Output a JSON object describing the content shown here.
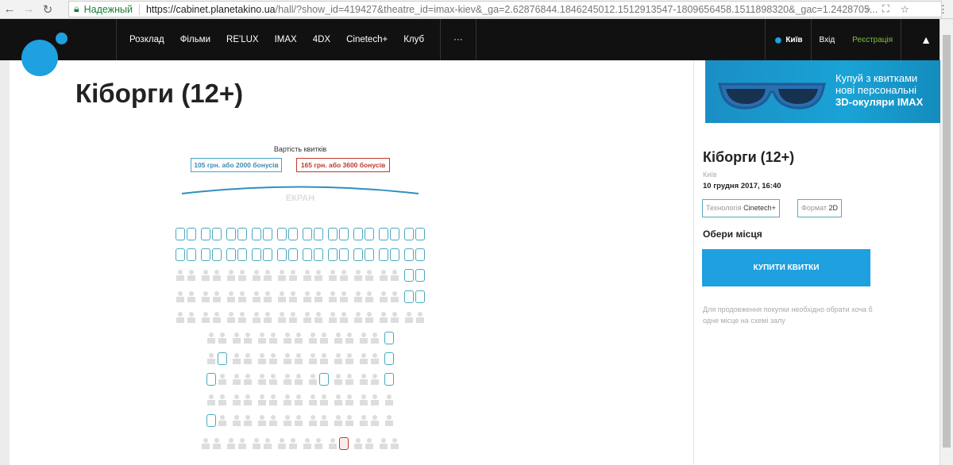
{
  "browser": {
    "secure_label": "Надежный",
    "url_host": "https://cabinet.planetakino.ua",
    "url_rest": "/hall/?show_id=419427&theatre_id=imax-kiev&_ga=2.62876844.1846245012.1512913547-1809656458.1511898320&_gac=1.2428705..."
  },
  "nav": {
    "items": [
      "Розклад",
      "Фільми",
      "RE'LUX",
      "IMAX",
      "4DX",
      "Cinetech+",
      "Клуб"
    ],
    "more": "···",
    "city": "Київ",
    "login": "Вхід",
    "register": "Реєстрація"
  },
  "title": "Кіборги (12+)",
  "hall": {
    "prices_title": "Вартість квитків",
    "price_standard": "105 грн. або 2000 бонусів",
    "price_vip": "165 грн. або 3600 бонусів",
    "screen_label": "ЕКРАН",
    "rows": [
      "aa aa aa aa aa aa aa aa aa aa",
      "aa aa aa aa aa aa aa aa aa aa",
      "oo oo oo oo oo oo oo oo oo aa",
      "oo oo oo oo oo oo oo oo oo aa",
      "oo oo oo oo oo oo oo oo oo oo",
      "oo oo oo oo oo oo oo a",
      "oa oo oo oo oo oo oo a",
      "ao oo oo oo oa oo oo a",
      "oo oo oo oo oo oo oo o",
      "ao oo oo oo oo oo oo o",
      "oo oo oo oo oo ov oo oo"
    ]
  },
  "colors": {
    "accent": "#1ea0e1",
    "vip": "#c0392b",
    "available": "#4aa9bf"
  },
  "sidebar": {
    "banner_line1": "Купуй з квитками",
    "banner_line2": "нові персональні",
    "banner_line3": "3D-окуляри IMAX",
    "title": "Кіборги (12+)",
    "city": "Київ",
    "datetime": "10 грудня 2017, 16:40",
    "tech_label": "Технологія",
    "tech_value": "Cinetech+",
    "format_label": "Формат",
    "format_value": "2D",
    "choose": "Обери місця",
    "buy": "КУПИТИ КВИТКИ",
    "hint": "Для продовження покупки необхідно обрати хоча б одне місце на схемі залу"
  }
}
